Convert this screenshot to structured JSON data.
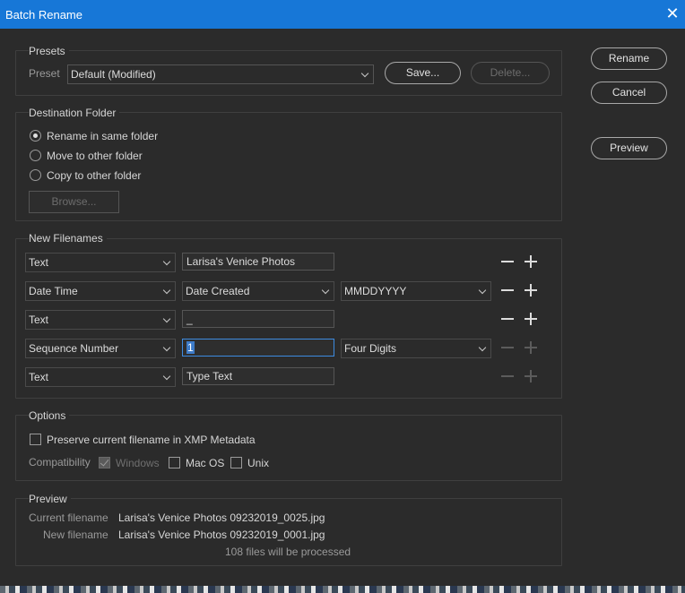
{
  "window": {
    "title": "Batch Rename"
  },
  "presets": {
    "group_title": "Presets",
    "preset_label": "Preset",
    "preset_value": "Default (Modified)",
    "save_label": "Save...",
    "delete_label": "Delete..."
  },
  "actions": {
    "rename": "Rename",
    "cancel": "Cancel",
    "preview": "Preview"
  },
  "destination": {
    "group_title": "Destination Folder",
    "options": [
      "Rename in same folder",
      "Move to other folder",
      "Copy to other folder"
    ],
    "selected": "Rename in same folder",
    "browse_label": "Browse..."
  },
  "filenames": {
    "group_title": "New Filenames",
    "rows": [
      {
        "type": "Text",
        "value": "Larisa's Venice Photos"
      },
      {
        "type": "Date Time",
        "option": "Date Created",
        "format": "MMDDYYYY"
      },
      {
        "type": "Text",
        "value": "_"
      },
      {
        "type": "Sequence Number",
        "value": "1",
        "format": "Four Digits"
      },
      {
        "type": "Text",
        "value": "Type Text"
      }
    ]
  },
  "options": {
    "group_title": "Options",
    "preserve_label": "Preserve current filename in XMP Metadata",
    "compat_label": "Compatibility",
    "windows": "Windows",
    "macos": "Mac OS",
    "unix": "Unix"
  },
  "preview": {
    "group_title": "Preview",
    "current_label": "Current filename",
    "current_value": "Larisa's Venice Photos 09232019_0025.jpg",
    "new_label": "New filename",
    "new_value": "Larisa's Venice Photos 09232019_0001.jpg",
    "count_text": "108 files will be processed"
  }
}
